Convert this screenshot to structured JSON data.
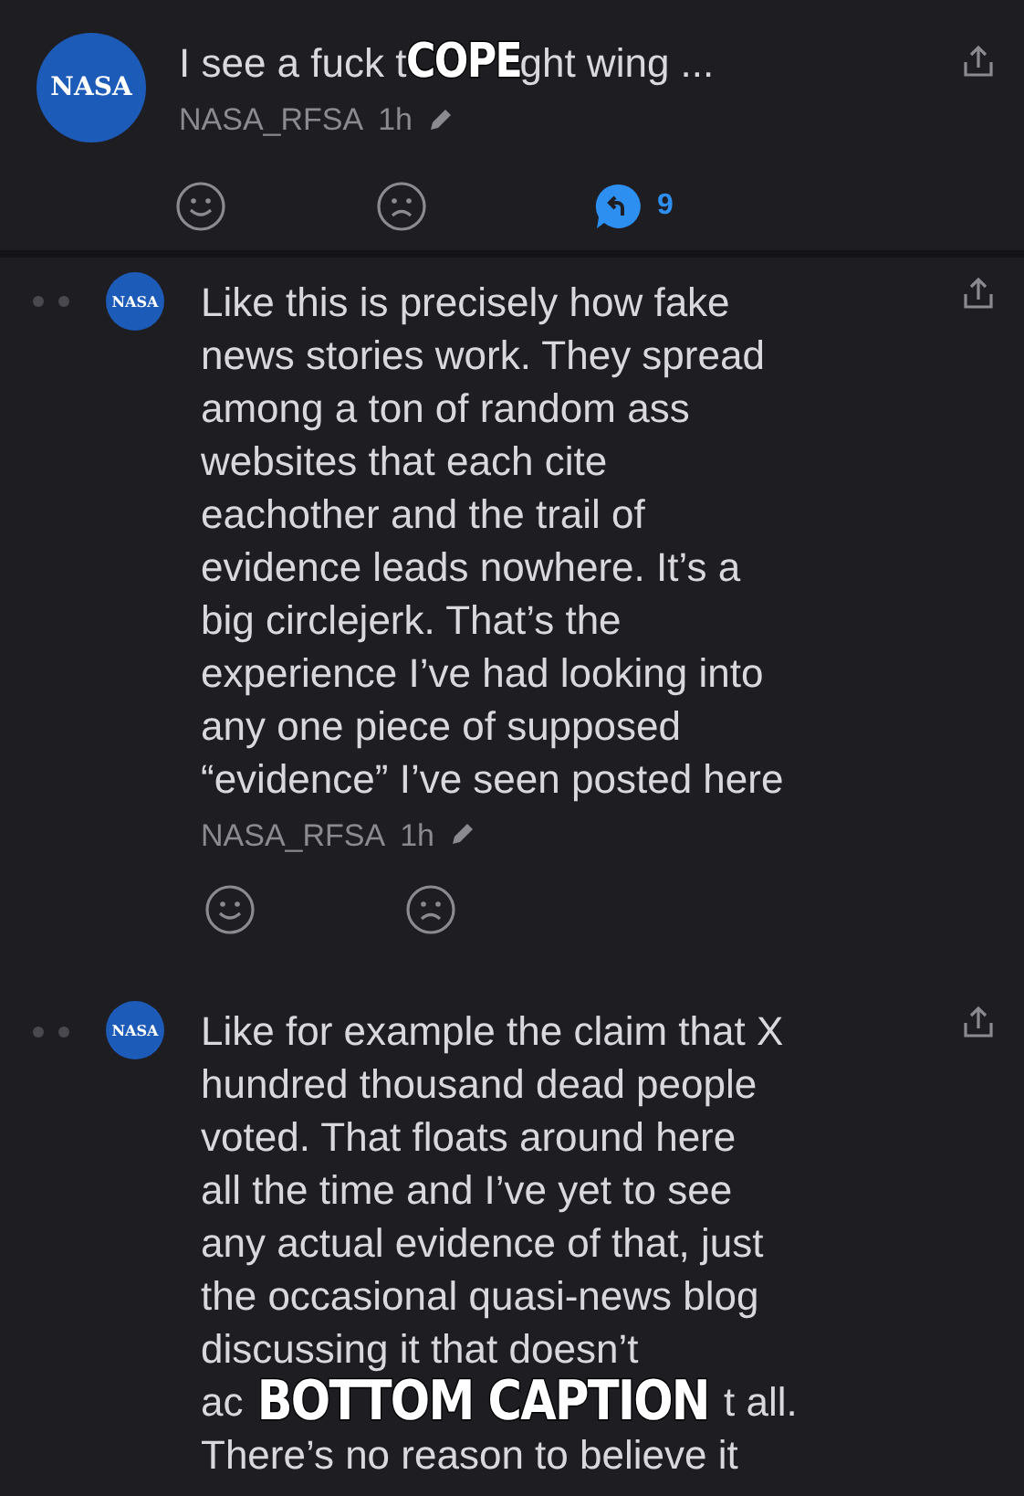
{
  "post": {
    "avatar_text": "NASA",
    "title_parts": [
      "I see a fuck t",
      "ght wing ..."
    ],
    "caption": "COPE",
    "author": "NASA_RFSA",
    "time": "1h",
    "edited": true,
    "reply_count": "9"
  },
  "comments": [
    {
      "avatar_text": "NASA",
      "lines": [
        "Like this is precisely how fake",
        "news stories work. They spread",
        "among a ton of random ass",
        "websites that each cite",
        "eachother and the trail of",
        "evidence leads nowhere. It’s a",
        "big circlejerk. That’s the",
        "experience I’ve had looking into",
        "any one piece of supposed",
        "“evidence” I’ve seen posted here"
      ],
      "author": "NASA_RFSA",
      "time": "1h",
      "edited": true
    },
    {
      "avatar_text": "NASA",
      "lines": [
        "Like for example the claim that X",
        "hundred thousand dead people",
        "voted. That floats around here",
        "all the time and I’ve yet to see",
        "any actual evidence of that, just",
        "the occasional quasi-news blog",
        "discussing it that doesn’t"
      ],
      "caption_line": [
        "ac",
        "t all."
      ],
      "caption": "BOTTOM CAPTION",
      "last_line": "There’s no reason to believe it"
    }
  ]
}
